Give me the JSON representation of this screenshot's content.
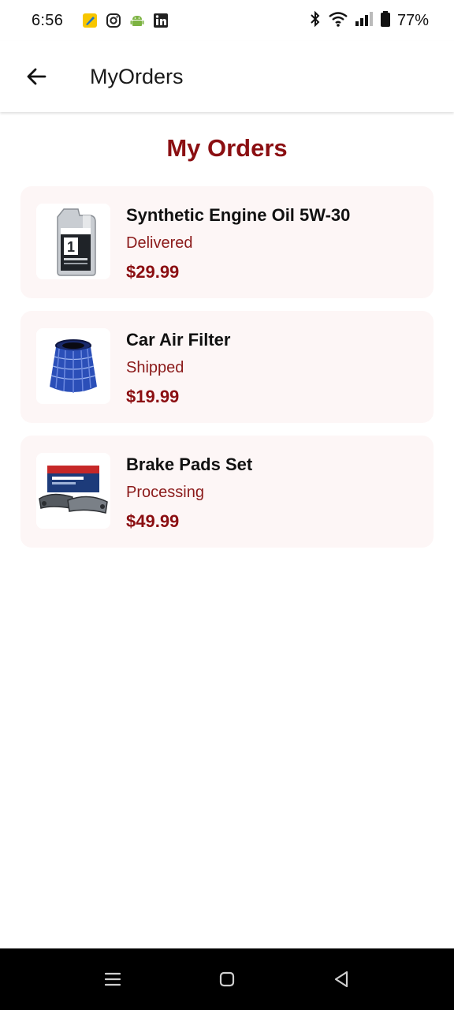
{
  "status_bar": {
    "time": "6:56",
    "battery": "77%",
    "apps": [
      "pen-app-icon",
      "instagram-icon",
      "android-icon",
      "linkedin-icon"
    ]
  },
  "app_bar": {
    "title": "MyOrders",
    "back_icon": "arrow-left-icon"
  },
  "page": {
    "heading": "My Orders"
  },
  "orders": [
    {
      "name": "Synthetic Engine Oil 5W-30",
      "status": "Delivered",
      "price": "$29.99",
      "image": "engine-oil-image"
    },
    {
      "name": "Car Air Filter",
      "status": "Shipped",
      "price": "$19.99",
      "image": "air-filter-image"
    },
    {
      "name": "Brake Pads Set",
      "status": "Processing",
      "price": "$49.99",
      "image": "brake-pads-image"
    }
  ],
  "nav_bar": {
    "items": [
      "menu-icon",
      "home-icon",
      "back-icon"
    ]
  },
  "colors": {
    "accent": "#8b0f12",
    "card_bg": "#fdf6f6",
    "nav_bg": "#000000"
  }
}
